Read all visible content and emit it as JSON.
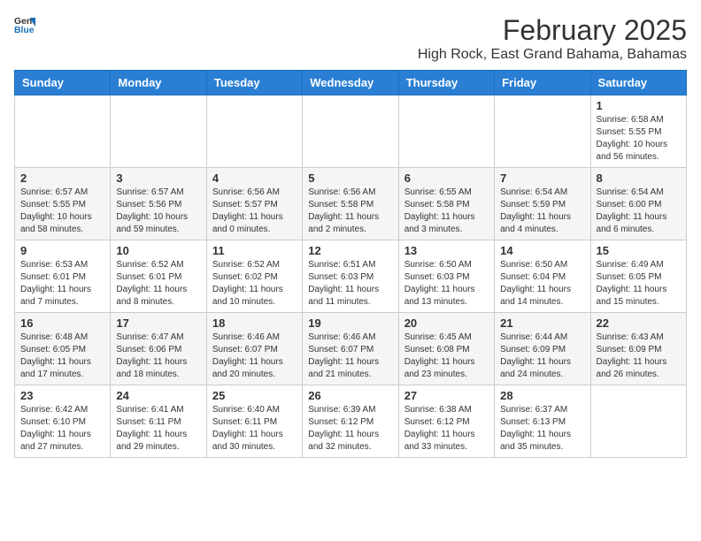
{
  "header": {
    "logo_general": "General",
    "logo_blue": "Blue",
    "month": "February 2025",
    "location": "High Rock, East Grand Bahama, Bahamas"
  },
  "days_of_week": [
    "Sunday",
    "Monday",
    "Tuesday",
    "Wednesday",
    "Thursday",
    "Friday",
    "Saturday"
  ],
  "weeks": [
    [
      {
        "day": "",
        "info": ""
      },
      {
        "day": "",
        "info": ""
      },
      {
        "day": "",
        "info": ""
      },
      {
        "day": "",
        "info": ""
      },
      {
        "day": "",
        "info": ""
      },
      {
        "day": "",
        "info": ""
      },
      {
        "day": "1",
        "info": "Sunrise: 6:58 AM\nSunset: 5:55 PM\nDaylight: 10 hours\nand 56 minutes."
      }
    ],
    [
      {
        "day": "2",
        "info": "Sunrise: 6:57 AM\nSunset: 5:55 PM\nDaylight: 10 hours\nand 58 minutes."
      },
      {
        "day": "3",
        "info": "Sunrise: 6:57 AM\nSunset: 5:56 PM\nDaylight: 10 hours\nand 59 minutes."
      },
      {
        "day": "4",
        "info": "Sunrise: 6:56 AM\nSunset: 5:57 PM\nDaylight: 11 hours\nand 0 minutes."
      },
      {
        "day": "5",
        "info": "Sunrise: 6:56 AM\nSunset: 5:58 PM\nDaylight: 11 hours\nand 2 minutes."
      },
      {
        "day": "6",
        "info": "Sunrise: 6:55 AM\nSunset: 5:58 PM\nDaylight: 11 hours\nand 3 minutes."
      },
      {
        "day": "7",
        "info": "Sunrise: 6:54 AM\nSunset: 5:59 PM\nDaylight: 11 hours\nand 4 minutes."
      },
      {
        "day": "8",
        "info": "Sunrise: 6:54 AM\nSunset: 6:00 PM\nDaylight: 11 hours\nand 6 minutes."
      }
    ],
    [
      {
        "day": "9",
        "info": "Sunrise: 6:53 AM\nSunset: 6:01 PM\nDaylight: 11 hours\nand 7 minutes."
      },
      {
        "day": "10",
        "info": "Sunrise: 6:52 AM\nSunset: 6:01 PM\nDaylight: 11 hours\nand 8 minutes."
      },
      {
        "day": "11",
        "info": "Sunrise: 6:52 AM\nSunset: 6:02 PM\nDaylight: 11 hours\nand 10 minutes."
      },
      {
        "day": "12",
        "info": "Sunrise: 6:51 AM\nSunset: 6:03 PM\nDaylight: 11 hours\nand 11 minutes."
      },
      {
        "day": "13",
        "info": "Sunrise: 6:50 AM\nSunset: 6:03 PM\nDaylight: 11 hours\nand 13 minutes."
      },
      {
        "day": "14",
        "info": "Sunrise: 6:50 AM\nSunset: 6:04 PM\nDaylight: 11 hours\nand 14 minutes."
      },
      {
        "day": "15",
        "info": "Sunrise: 6:49 AM\nSunset: 6:05 PM\nDaylight: 11 hours\nand 15 minutes."
      }
    ],
    [
      {
        "day": "16",
        "info": "Sunrise: 6:48 AM\nSunset: 6:05 PM\nDaylight: 11 hours\nand 17 minutes."
      },
      {
        "day": "17",
        "info": "Sunrise: 6:47 AM\nSunset: 6:06 PM\nDaylight: 11 hours\nand 18 minutes."
      },
      {
        "day": "18",
        "info": "Sunrise: 6:46 AM\nSunset: 6:07 PM\nDaylight: 11 hours\nand 20 minutes."
      },
      {
        "day": "19",
        "info": "Sunrise: 6:46 AM\nSunset: 6:07 PM\nDaylight: 11 hours\nand 21 minutes."
      },
      {
        "day": "20",
        "info": "Sunrise: 6:45 AM\nSunset: 6:08 PM\nDaylight: 11 hours\nand 23 minutes."
      },
      {
        "day": "21",
        "info": "Sunrise: 6:44 AM\nSunset: 6:09 PM\nDaylight: 11 hours\nand 24 minutes."
      },
      {
        "day": "22",
        "info": "Sunrise: 6:43 AM\nSunset: 6:09 PM\nDaylight: 11 hours\nand 26 minutes."
      }
    ],
    [
      {
        "day": "23",
        "info": "Sunrise: 6:42 AM\nSunset: 6:10 PM\nDaylight: 11 hours\nand 27 minutes."
      },
      {
        "day": "24",
        "info": "Sunrise: 6:41 AM\nSunset: 6:11 PM\nDaylight: 11 hours\nand 29 minutes."
      },
      {
        "day": "25",
        "info": "Sunrise: 6:40 AM\nSunset: 6:11 PM\nDaylight: 11 hours\nand 30 minutes."
      },
      {
        "day": "26",
        "info": "Sunrise: 6:39 AM\nSunset: 6:12 PM\nDaylight: 11 hours\nand 32 minutes."
      },
      {
        "day": "27",
        "info": "Sunrise: 6:38 AM\nSunset: 6:12 PM\nDaylight: 11 hours\nand 33 minutes."
      },
      {
        "day": "28",
        "info": "Sunrise: 6:37 AM\nSunset: 6:13 PM\nDaylight: 11 hours\nand 35 minutes."
      },
      {
        "day": "",
        "info": ""
      }
    ]
  ]
}
